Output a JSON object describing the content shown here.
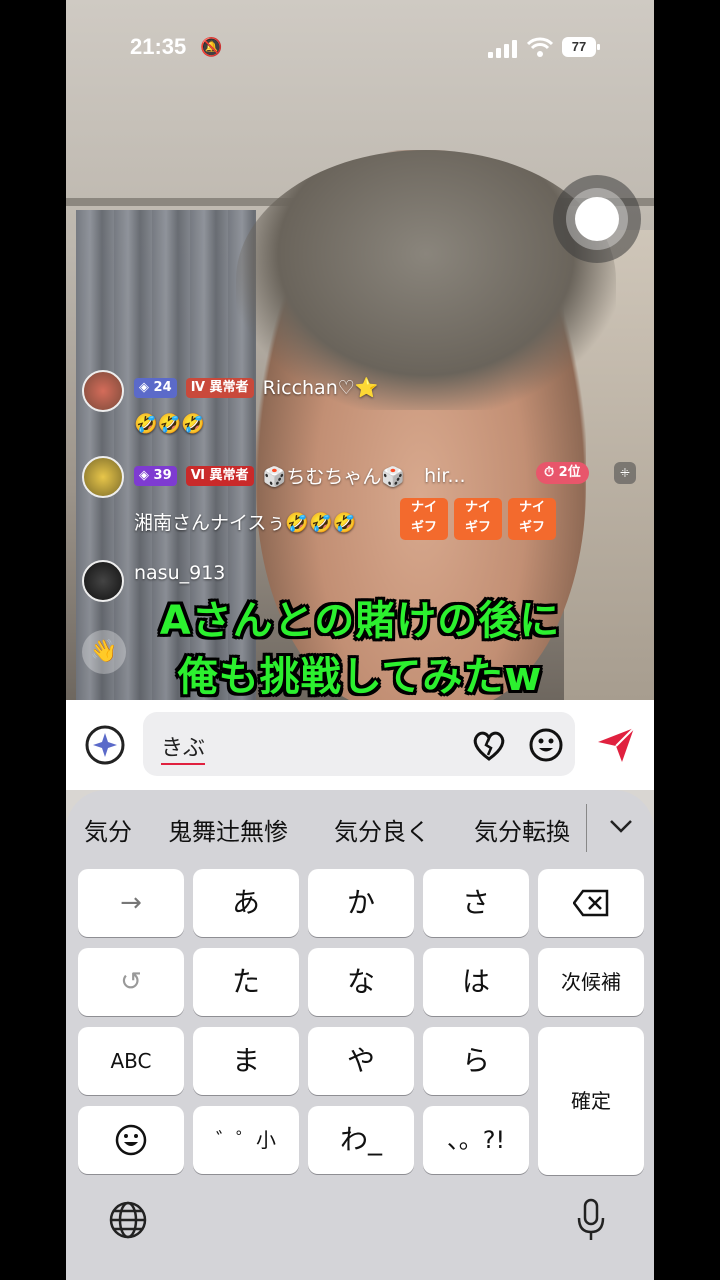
{
  "status": {
    "time": "21:35",
    "battery": "77"
  },
  "comments": [
    {
      "level": "24",
      "rank_label": "異常者",
      "username": "Ricchan♡⭐",
      "message": "🤣🤣🤣"
    },
    {
      "level": "39",
      "rank_label": "異常者",
      "username": "🎲ちむちゃん🎲",
      "trailing": "hir...",
      "position": "2位",
      "message": "湘南さんナイスぅ🤣🤣🤣"
    },
    {
      "username": "nasu_913"
    }
  ],
  "gift_tiles": [
    {
      "line1": "ナイ",
      "line2": "ギフ"
    },
    {
      "line1": "ナイ",
      "line2": "ギフ"
    },
    {
      "line1": "ナイ",
      "line2": "ギフ"
    }
  ],
  "caption": {
    "line1": "Aさんとの賭けの後に",
    "line2": "俺も挑戦してみたw"
  },
  "input": {
    "text": "きぶ"
  },
  "candidates": [
    "気分",
    "鬼舞辻無惨",
    "気分良く",
    "気分転換"
  ],
  "keys": {
    "arrow": "→",
    "a": "あ",
    "ka": "か",
    "sa": "さ",
    "ta": "た",
    "na": "な",
    "ha": "は",
    "next": "次候補",
    "abc": "ABC",
    "ma": "ま",
    "ya": "や",
    "ra": "ら",
    "confirm": "確定",
    "dakuten": "゛゜小",
    "wa": "わ_",
    "punct": "、。?!"
  },
  "colors": {
    "caption": "#2cf02f",
    "send": "#e0213f",
    "gift": "#f36a2d"
  }
}
